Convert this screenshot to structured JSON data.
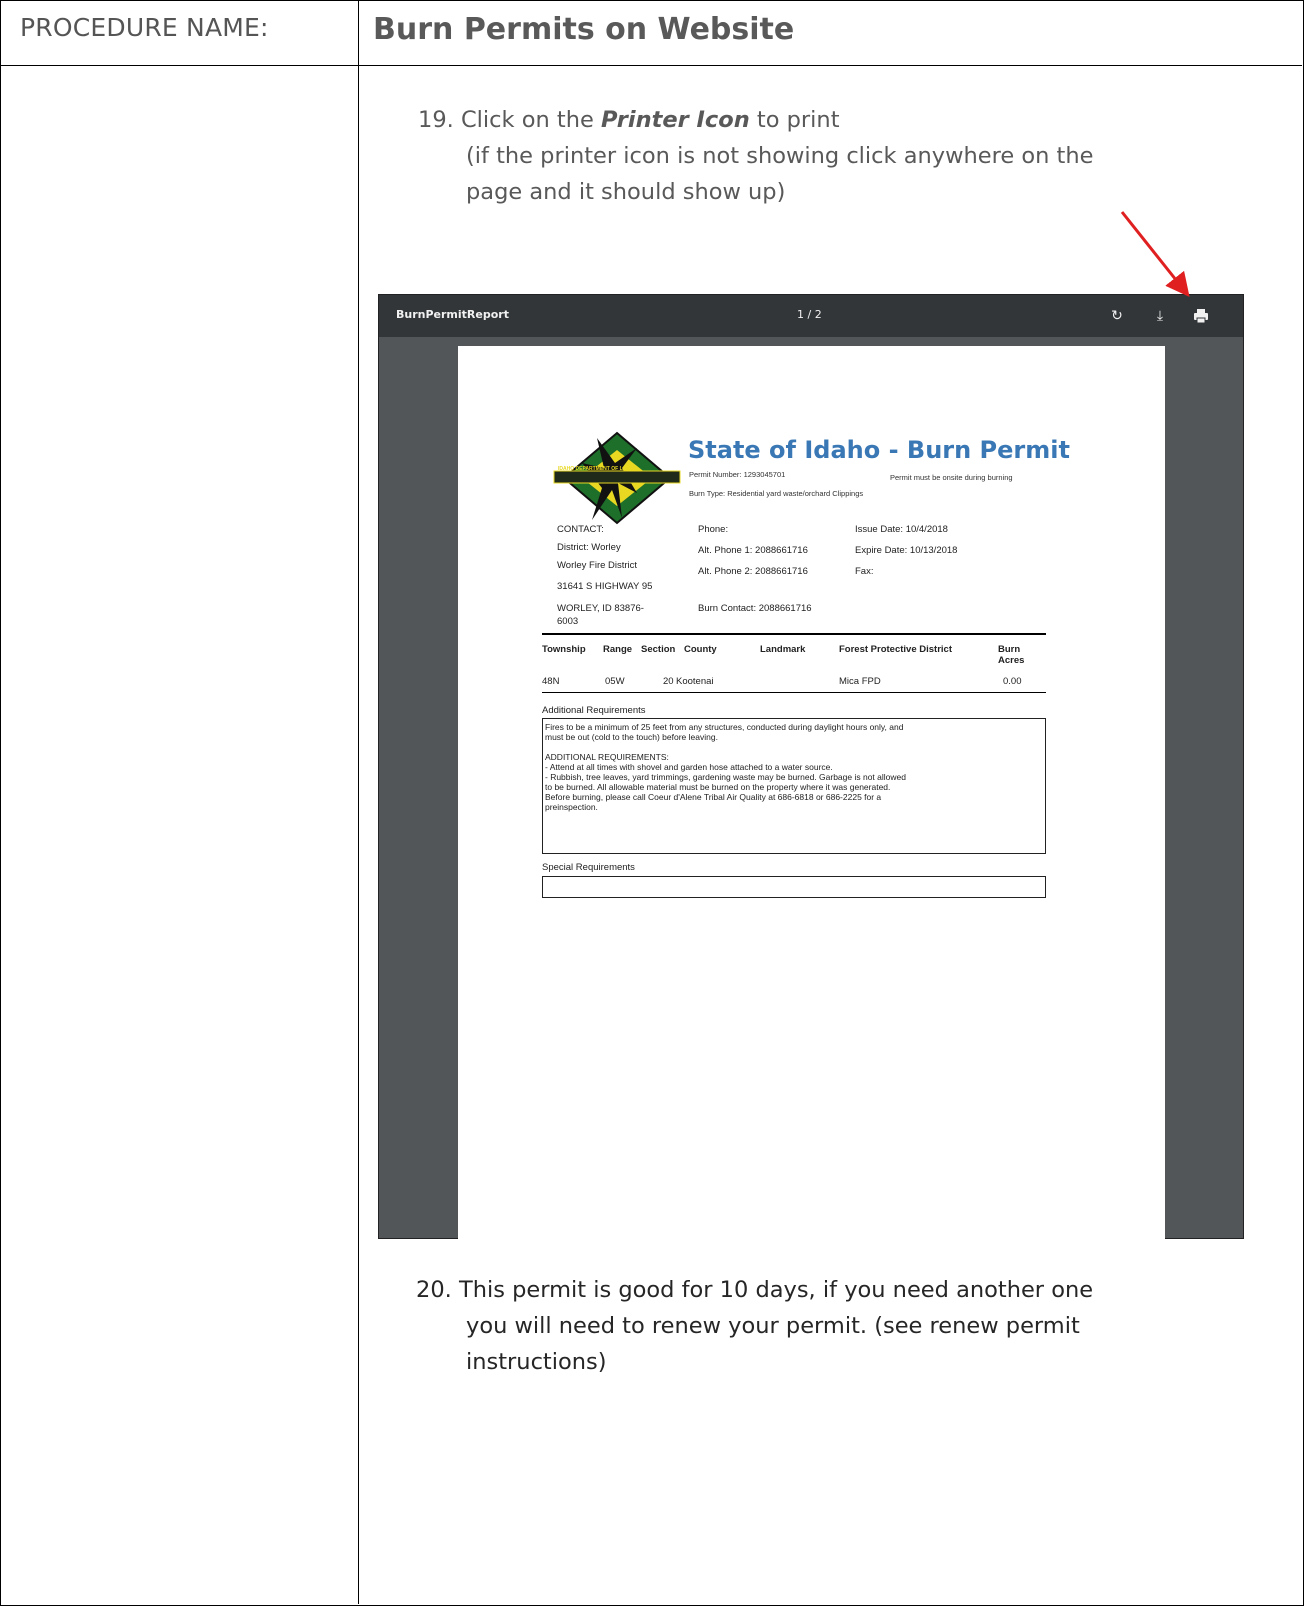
{
  "header": {
    "label": "PROCEDURE NAME:",
    "name": "Burn Permits on Website"
  },
  "step19": {
    "number": "19.",
    "text_before": "Click on the",
    "emphasis": "Printer Icon",
    "text_after": "to print",
    "note_line1": "(if the printer icon is not showing click anywhere on the",
    "note_line2": "page and it should show up)"
  },
  "viewer": {
    "title": "BurnPermitReport",
    "page_indicator": "1 / 2",
    "icons": [
      "rotate-icon",
      "download-icon",
      "print-icon"
    ],
    "toolbar_color": "#323639",
    "background_color": "#525659"
  },
  "permit": {
    "title": "State of Idaho - Burn Permit",
    "permit_number": "Permit Number: 1293045701",
    "permit_note": "Permit must be onsite during burning",
    "burn_type": "Burn Type: Residential yard waste/orchard Clippings",
    "logo_caption": "IDAHO DEPARTMENT OF LANDS",
    "contact": {
      "label": "CONTACT:",
      "line1": "District: Worley",
      "line2": "Worley Fire District",
      "line3": "31641 S HIGHWAY 95",
      "line4": "WORLEY, ID 83876-",
      "line5": "6003"
    },
    "phones": {
      "phone": "Phone:",
      "alt1": "Alt. Phone 1: 2088661716",
      "alt2": "Alt. Phone 2: 2088661716",
      "burn_contact": "Burn Contact: 2088661716"
    },
    "dates": {
      "issue": "Issue Date: 10/4/2018",
      "expire": "Expire Date: 10/13/2018",
      "fax": "Fax:"
    },
    "table": {
      "headers": [
        "Township",
        "Range",
        "Section",
        "County",
        "Landmark",
        "Forest Protective District",
        "Burn Acres"
      ],
      "row": [
        "48N",
        "05W",
        "20",
        "Kootenai",
        "",
        "Mica FPD",
        "0.00"
      ]
    },
    "additional_label": "Additional Requirements",
    "additional_text": [
      "Fires to be a minimum of 25 feet from any structures, conducted during daylight hours only, and",
      "must be out (cold to the touch) before leaving.",
      "",
      "ADDITIONAL REQUIREMENTS:",
      "- Attend at all times with shovel and garden hose attached to a water source.",
      "- Rubbish, tree leaves, yard trimmings, gardening waste may be burned. Garbage is not allowed",
      "to be burned. All allowable material must be burned on the property where it was generated.",
      "Before burning, please call Coeur d'Alene Tribal Air Quality at 686-6818 or 686-2225 for a",
      "preinspection."
    ],
    "special_label": "Special Requirements",
    "title_color": "#3a78b5"
  },
  "step20": {
    "number": "20.",
    "line1": "This permit is good for 10 days, if you need another one",
    "line2": "you will need to renew your permit.  (see renew permit",
    "line3": "instructions)"
  },
  "arrow_color": "#e02020"
}
